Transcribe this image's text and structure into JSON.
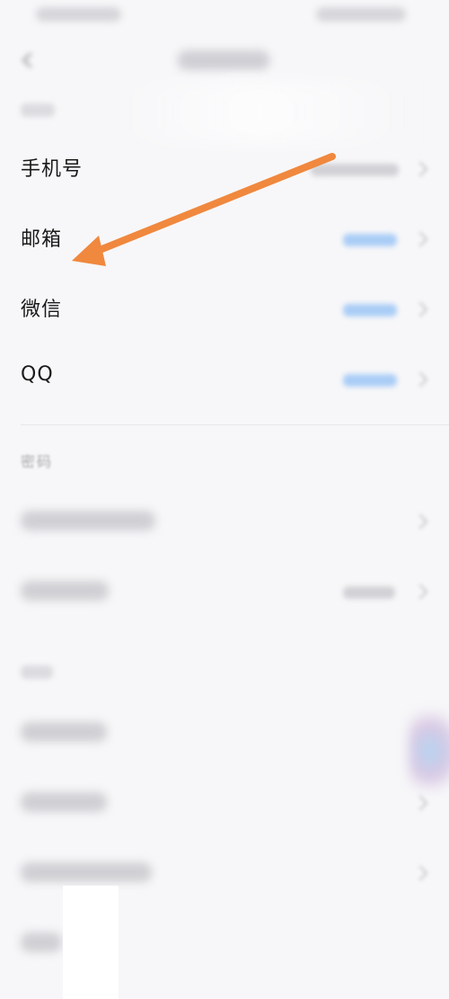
{
  "accounts": {
    "items": [
      {
        "id": "phone",
        "label": "手机号",
        "state": "bound"
      },
      {
        "id": "email",
        "label": "邮箱",
        "state": "unbound"
      },
      {
        "id": "wechat",
        "label": "微信",
        "state": "unbound"
      },
      {
        "id": "qq",
        "label": "QQ",
        "state": "unbound"
      }
    ]
  },
  "password": {
    "section_label": "密码"
  },
  "colors": {
    "arrow": "#f0883e",
    "unbound_value": "#aacdf6",
    "label_text": "#1a1a1a",
    "section_label": "#a8a8ad"
  },
  "icons": [
    "back-arrow-icon",
    "chevron-right-icon"
  ]
}
